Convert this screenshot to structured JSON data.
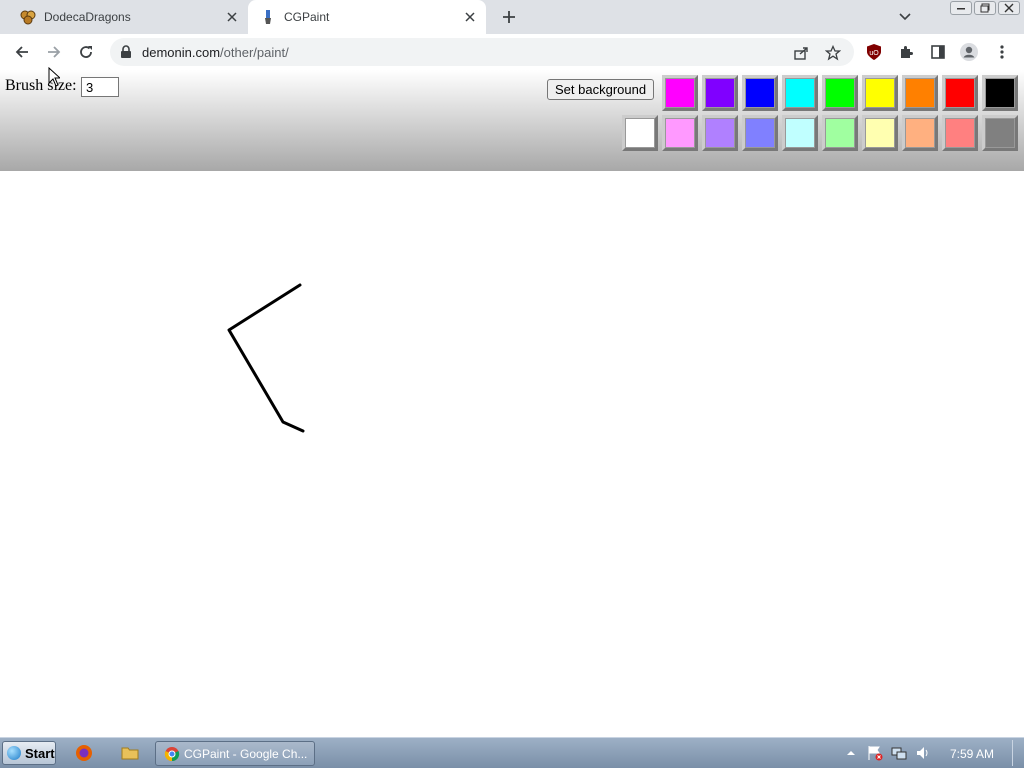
{
  "browser": {
    "tabs": [
      {
        "title": "DodecaDragons",
        "favicon": "dragon-icon",
        "active": false
      },
      {
        "title": "CGPaint",
        "favicon": "paintbrush-icon",
        "active": true
      }
    ],
    "url_host": "demonin.com",
    "url_path": "/other/paint/"
  },
  "paint": {
    "brush_label": "Brush size:",
    "brush_size": "3",
    "set_background_label": "Set background",
    "palette_row1": [
      "#ff00ff",
      "#8000ff",
      "#0000ff",
      "#00ffff",
      "#00ff00",
      "#ffff00",
      "#ff8000",
      "#ff0000",
      "#000000"
    ],
    "palette_row2": [
      "#ffffff",
      "#ff99ff",
      "#b080ff",
      "#8080ff",
      "#c0ffff",
      "#a0ffa0",
      "#ffffb0",
      "#ffb080",
      "#ff8080",
      "#808080"
    ],
    "stroke_color": "#000000"
  },
  "taskbar": {
    "start_label": "Start",
    "task_label": "CGPaint - Google Ch...",
    "clock": "7:59 AM"
  }
}
